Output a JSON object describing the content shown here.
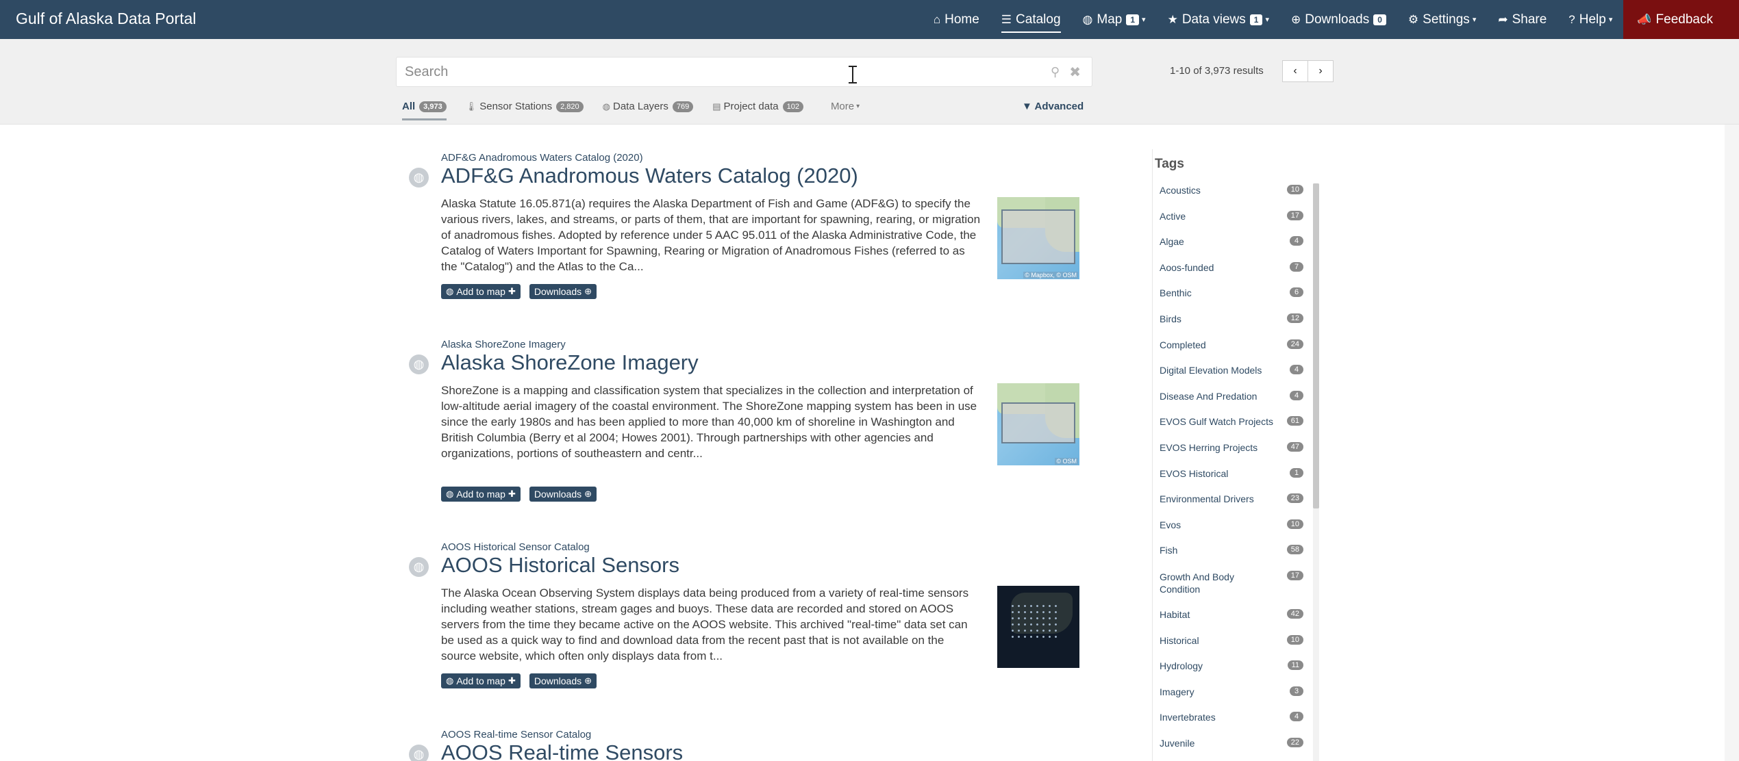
{
  "brand": "Gulf of Alaska Data Portal",
  "nav": {
    "home": "Home",
    "catalog": "Catalog",
    "map": "Map",
    "map_badge": "1",
    "data_views": "Data views",
    "data_views_badge": "1",
    "downloads": "Downloads",
    "downloads_badge": "0",
    "settings": "Settings",
    "share": "Share",
    "help": "Help",
    "feedback": "Feedback"
  },
  "search": {
    "placeholder": "Search",
    "results_count": "1-10 of 3,973 results"
  },
  "filters": {
    "all": "All",
    "all_count": "3,973",
    "sensor_stations": "Sensor Stations",
    "sensor_stations_count": "2,820",
    "data_layers": "Data Layers",
    "data_layers_count": "769",
    "project_data": "Project data",
    "project_data_count": "102",
    "more": "More",
    "advanced": "Advanced"
  },
  "results": [
    {
      "source": "ADF&G Anadromous Waters Catalog (2020)",
      "title": "ADF&G Anadromous Waters Catalog (2020)",
      "description": "Alaska Statute 16.05.871(a) requires the Alaska Department of Fish and Game (ADF&G) to specify the various rivers, lakes, and streams, or parts of them, that are important for spawning, rearing, or migration of anadromous fishes. Adopted by reference under 5 AAC 95.011 of the Alaska Administrative Code, the Catalog of Waters Important for Spawning, Rearing or Migration of Anadromous Fishes (referred to as the \"Catalog\") and the Atlas to the Ca...",
      "add_label": "Add to map",
      "downloads_label": "Downloads",
      "thumb_attr": "© Mapbox, © OSM"
    },
    {
      "source": "Alaska ShoreZone Imagery",
      "title": "Alaska ShoreZone Imagery",
      "description": "ShoreZone is a mapping and classification system that specializes in the collection and interpretation of low-altitude aerial imagery of the coastal environment. The ShoreZone mapping system has been in use since the early 1980s and has been applied to more than 40,000 km of shoreline in Washington and British Columbia (Berry et al 2004; Howes 2001). Through partnerships with other agencies and organizations, portions of southeastern and centr...",
      "add_label": "Add to map",
      "downloads_label": "Downloads",
      "thumb_attr": "© OSM"
    },
    {
      "source": "AOOS Historical Sensor Catalog",
      "title": "AOOS Historical Sensors",
      "description": "The Alaska Ocean Observing System displays data being produced from a variety of real-time sensors including weather stations, stream gages and buoys. These data are recorded and stored on AOOS servers from the time they became active on the AOOS website. This archived \"real-time\" data set can be used as a quick way to find and download data from the recent past that is not available on the source website, which often only displays data from t...",
      "add_label": "Add to map",
      "downloads_label": "Downloads"
    },
    {
      "source": "AOOS Real-time Sensor Catalog",
      "title": "AOOS Real-time Sensors"
    }
  ],
  "tags": {
    "title": "Tags",
    "items": [
      {
        "name": "Acoustics",
        "count": "10"
      },
      {
        "name": "Active",
        "count": "17"
      },
      {
        "name": "Algae",
        "count": "4"
      },
      {
        "name": "Aoos-funded",
        "count": "7"
      },
      {
        "name": "Benthic",
        "count": "6"
      },
      {
        "name": "Birds",
        "count": "12"
      },
      {
        "name": "Completed",
        "count": "24"
      },
      {
        "name": "Digital Elevation Models",
        "count": "4"
      },
      {
        "name": "Disease And Predation",
        "count": "4"
      },
      {
        "name": "EVOS Gulf Watch Projects",
        "count": "61"
      },
      {
        "name": "EVOS Herring Projects",
        "count": "47"
      },
      {
        "name": "EVOS Historical",
        "count": "1"
      },
      {
        "name": "Environmental Drivers",
        "count": "23"
      },
      {
        "name": "Evos",
        "count": "10"
      },
      {
        "name": "Fish",
        "count": "58"
      },
      {
        "name": "Growth And Body Condition",
        "count": "17"
      },
      {
        "name": "Habitat",
        "count": "42"
      },
      {
        "name": "Historical",
        "count": "10"
      },
      {
        "name": "Hydrology",
        "count": "11"
      },
      {
        "name": "Imagery",
        "count": "3"
      },
      {
        "name": "Invertebrates",
        "count": "4"
      },
      {
        "name": "Juvenile",
        "count": "22"
      }
    ]
  }
}
